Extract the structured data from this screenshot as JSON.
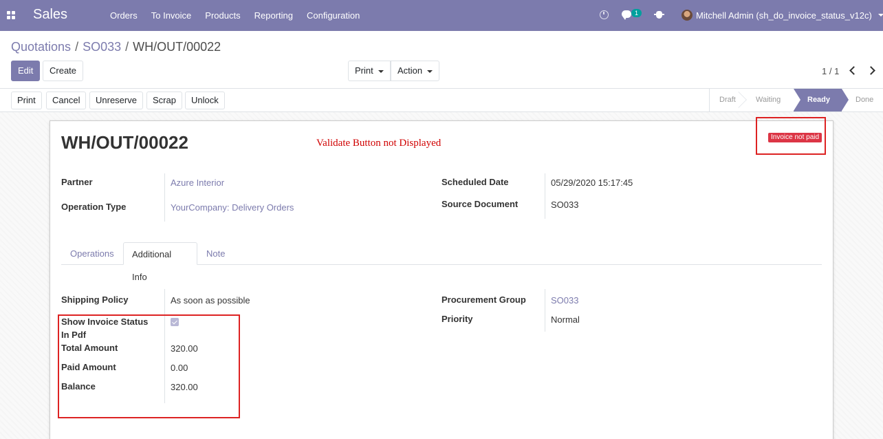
{
  "navbar": {
    "app_title": "Sales",
    "menu": [
      "Orders",
      "To Invoice",
      "Products",
      "Reporting",
      "Configuration"
    ],
    "chat_count": "1",
    "user_name": "Mitchell Admin (sh_do_invoice_status_v12c)",
    "accent_color": "#7c7bad"
  },
  "breadcrumb": {
    "items": [
      "Quotations",
      "SO033"
    ],
    "current": "WH/OUT/00022",
    "separator": "/"
  },
  "control_panel": {
    "edit_label": "Edit",
    "create_label": "Create",
    "print_label": "Print",
    "action_label": "Action",
    "pager": "1 / 1"
  },
  "header_buttons": [
    "Print",
    "Cancel",
    "Unreserve",
    "Scrap",
    "Unlock"
  ],
  "statusbar": {
    "stages": [
      "Draft",
      "Waiting",
      "Ready",
      "Done"
    ],
    "active": "Ready"
  },
  "record": {
    "title": "WH/OUT/00022",
    "annotation": "Validate Button not Displayed",
    "invoice_badge": "Invoice not paid",
    "fields_left": [
      {
        "label": "Partner",
        "value": "Azure Interior"
      },
      {
        "label": "Operation Type",
        "value": "YourCompany: Delivery Orders"
      }
    ],
    "fields_right": [
      {
        "label": "Scheduled Date",
        "value": "05/29/2020 15:17:45"
      },
      {
        "label": "Source Document",
        "value": "SO033"
      }
    ]
  },
  "tabs": [
    "Operations",
    "Additional Info",
    "Note"
  ],
  "additional_info": {
    "shipping_policy_label": "Shipping Policy",
    "shipping_policy_value": "As soon as possible",
    "show_invoice_label_1": "Show Invoice Status",
    "show_invoice_label_2": "In Pdf",
    "show_invoice_checked": true,
    "total_amount_label": "Total Amount",
    "total_amount_value": "320.00",
    "paid_amount_label": "Paid Amount",
    "paid_amount_value": "0.00",
    "balance_label": "Balance",
    "balance_value": "320.00",
    "procurement_group_label": "Procurement Group",
    "procurement_group_value": "SO033",
    "priority_label": "Priority",
    "priority_value": "Normal"
  }
}
